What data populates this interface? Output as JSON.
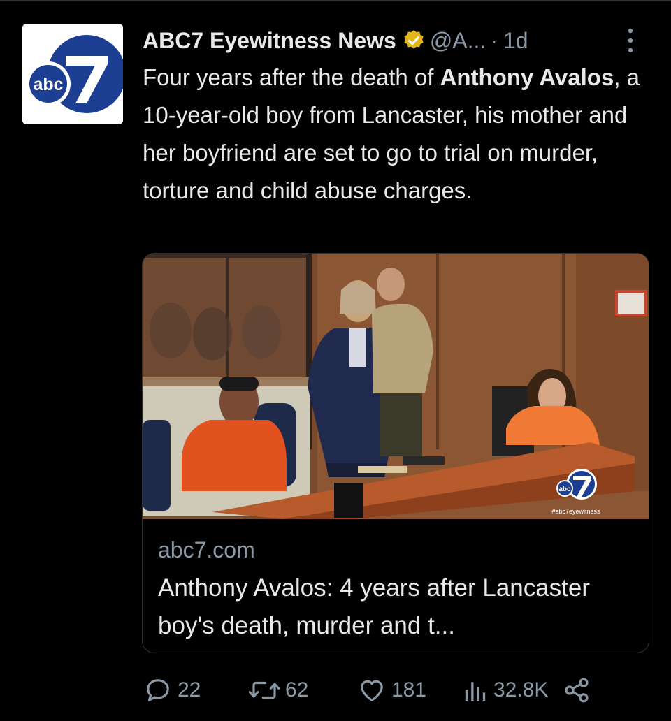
{
  "tweet": {
    "author_name": "ABC7 Eyewitness News",
    "handle": "@A...",
    "separator": "·",
    "time": "1d",
    "text_parts": {
      "p1": "Four years after the death of ",
      "p2": "Anthony Avalos",
      "p3": ", a 10-year-old boy from Lancaster, his mother and her boyfriend are set to go to trial on murder, torture and child abuse charges."
    }
  },
  "avatar": {
    "logo_text": "abc",
    "logo_number": "7"
  },
  "card": {
    "domain": "abc7.com",
    "title": "Anthony Avalos: 4 years after Lancaster boy's death, murder and t...",
    "image_watermark_hashtag": "#abc7eyewitness",
    "image_watermark_logo": "abc"
  },
  "actions": {
    "replies": "22",
    "retweets": "62",
    "likes": "181",
    "views": "32.8K"
  },
  "icons": {
    "verified": "verified-badge-icon",
    "more": "more-dots-icon",
    "reply": "reply-bubble-icon",
    "retweet": "retweet-icon",
    "like": "heart-icon",
    "views": "views-bar-chart-icon",
    "share": "share-icon"
  },
  "colors": {
    "background": "#000000",
    "text_primary": "#e7e9ea",
    "text_secondary": "#8b98a5",
    "verified_gold": "#e2b719",
    "abc_blue": "#1c3f94",
    "border": "#2f3336"
  }
}
